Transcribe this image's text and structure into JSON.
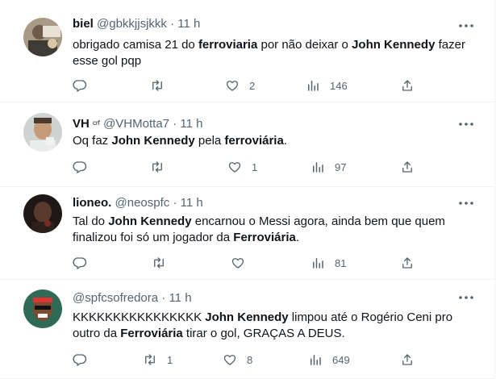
{
  "tweets": [
    {
      "name": "biel",
      "name_sup": "",
      "handle": "@gbkkjjsjkkk",
      "dot": "·",
      "time": "11 h",
      "text": [
        {
          "t": "obrigado camisa 21 do ",
          "b": false
        },
        {
          "t": "ferroviaria",
          "b": true
        },
        {
          "t": " por não deixar o ",
          "b": false
        },
        {
          "t": "John Kennedy",
          "b": true
        },
        {
          "t": " fazer esse gol pqp",
          "b": false
        }
      ],
      "replies": "",
      "retweets": "",
      "likes": "2",
      "views": "146"
    },
    {
      "name": "VH",
      "name_sup": "crf",
      "handle": "@VHMotta7",
      "dot": "·",
      "time": "11 h",
      "text": [
        {
          "t": "Oq faz ",
          "b": false
        },
        {
          "t": "John Kennedy",
          "b": true
        },
        {
          "t": " pela ",
          "b": false
        },
        {
          "t": "ferroviária",
          "b": true
        },
        {
          "t": ".",
          "b": false
        }
      ],
      "replies": "",
      "retweets": "",
      "likes": "1",
      "views": "97"
    },
    {
      "name": "lioneo.",
      "name_sup": "",
      "handle": "@neospfc",
      "dot": "·",
      "time": "11 h",
      "text": [
        {
          "t": "Tal do ",
          "b": false
        },
        {
          "t": "John Kennedy",
          "b": true
        },
        {
          "t": " encarnou o Messi agora, ainda bem que quem finalizou foi só um jogador da ",
          "b": false
        },
        {
          "t": "Ferroviária",
          "b": true
        },
        {
          "t": ".",
          "b": false
        }
      ],
      "replies": "",
      "retweets": "",
      "likes": "",
      "views": "81"
    },
    {
      "name": "",
      "name_sup": "",
      "handle": "@spfcsofredora",
      "dot": "·",
      "time": "11 h",
      "text": [
        {
          "t": "KKKKKKKKKKKKKKKK ",
          "b": false
        },
        {
          "t": "John Kennedy",
          "b": true
        },
        {
          "t": " limpou até o Rogério Ceni pro outro da ",
          "b": false
        },
        {
          "t": "Ferroviária",
          "b": true
        },
        {
          "t": " tirar o gol, GRAÇAS A DEUS.",
          "b": false
        }
      ],
      "replies": "",
      "retweets": "1",
      "likes": "8",
      "views": "649"
    }
  ],
  "icons": {
    "more": "more-icon",
    "reply": "reply-icon",
    "retweet": "retweet-icon",
    "like": "like-icon",
    "views": "views-icon",
    "share": "share-icon"
  },
  "colors": {
    "text": "#0f1419",
    "muted": "#536471",
    "divider": "#eff3f4"
  }
}
